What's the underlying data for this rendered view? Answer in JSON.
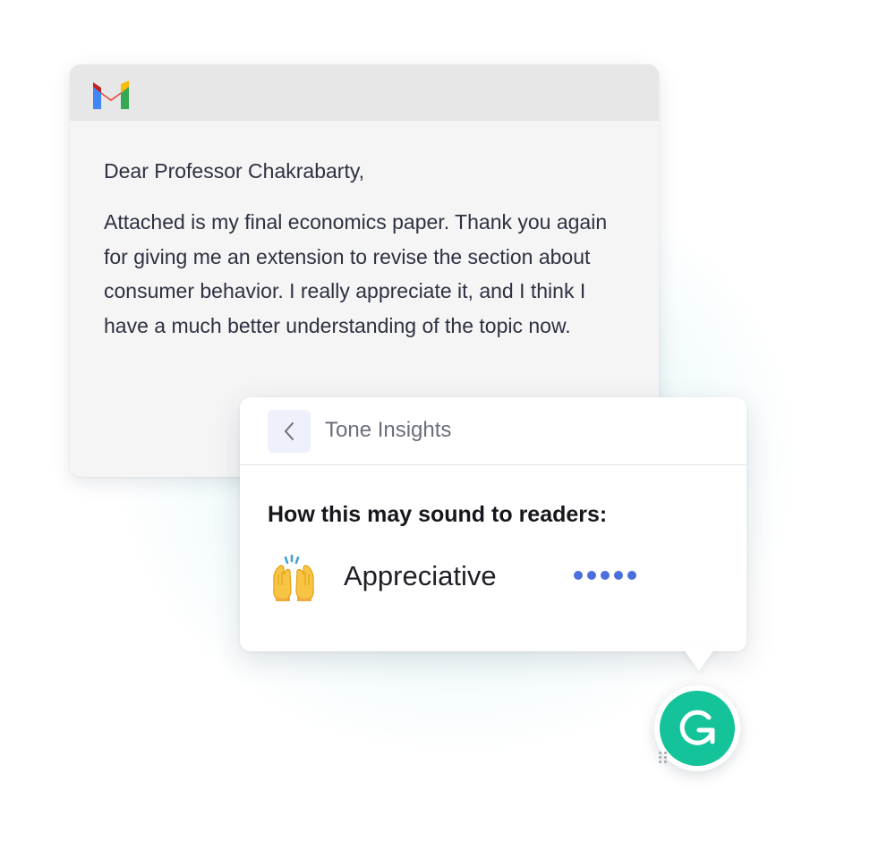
{
  "email": {
    "app_icon": "gmail-icon",
    "greeting": "Dear Professor Chakrabarty,",
    "body": "Attached is my final economics paper. Thank you again for giving me an extension to revise the section about consumer behavior. I really appreciate it, and I think I have a much better understanding of the topic now."
  },
  "tone_panel": {
    "back_icon": "chevron-left-icon",
    "title": "Tone Insights",
    "question": "How this may sound to readers:",
    "tone": {
      "emoji_icon": "raising-hands-icon",
      "label": "Appreciative",
      "intensity": 5,
      "intensity_max": 5
    }
  },
  "assistant": {
    "icon": "grammarly-logo-icon"
  },
  "colors": {
    "accent_green": "#15c39a",
    "dot_blue": "#4a6fdc",
    "back_button_bg": "#eef0fb"
  }
}
